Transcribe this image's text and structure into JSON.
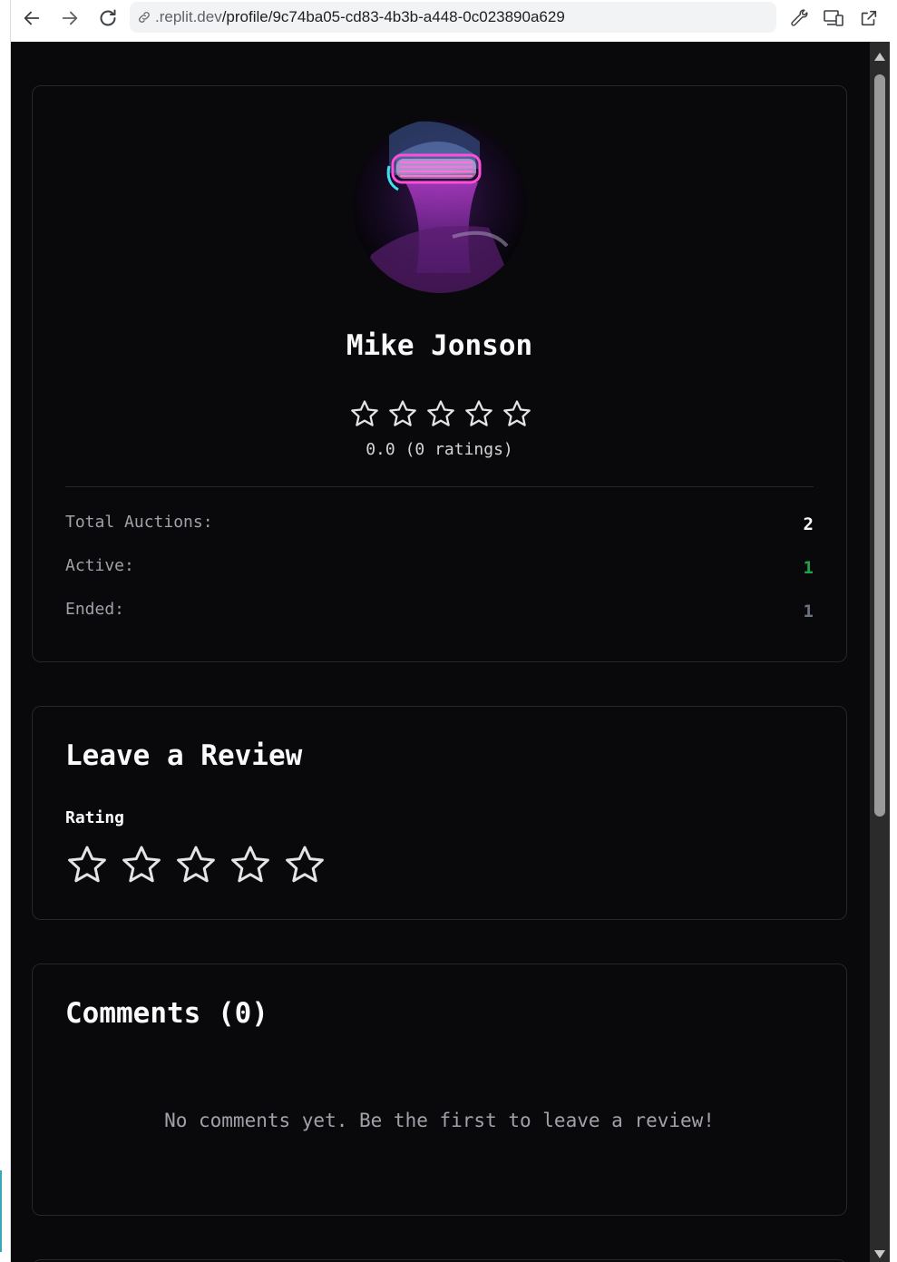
{
  "browser": {
    "url_prefix": ".replit.dev",
    "url_path": "/profile/9c74ba05-cd83-4b3b-a448-0c023890a629"
  },
  "profile": {
    "name": "Mike Jonson",
    "rating_value": 0,
    "rating_text": "0.0 (0 ratings)",
    "stats": [
      {
        "label": "Total Auctions:",
        "value": "2",
        "color": "#fafafa"
      },
      {
        "label": "Active:",
        "value": "1",
        "color": "#22a34a"
      },
      {
        "label": "Ended:",
        "value": "1",
        "color": "#6b7280"
      }
    ]
  },
  "review": {
    "title": "Leave a Review",
    "rating_label": "Rating",
    "selected_stars": 0
  },
  "comments": {
    "title": "Comments (0)",
    "empty_text": "No comments yet. Be the first to leave a review!"
  },
  "colors": {
    "background": "#09090b",
    "card_border": "#27272a",
    "text_primary": "#fafafa",
    "text_muted": "#a1a1aa"
  }
}
